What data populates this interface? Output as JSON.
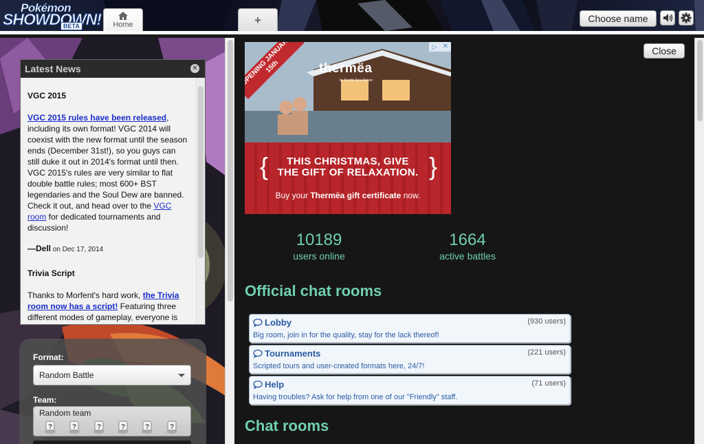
{
  "header": {
    "logo_line1": "Pokémon",
    "logo_line2": "SHOWDOWN!",
    "logo_badge": "BETA",
    "home_tab_label": "Home",
    "new_tab_label": "+",
    "choose_name_label": "Choose name",
    "sound_icon": "speaker-icon",
    "settings_icon": "gear-icon"
  },
  "news": {
    "title": "Latest News",
    "items": [
      {
        "heading": "VGC 2015",
        "link1": "VGC 2015 rules have been released",
        "text1": ", including its own format! VGC 2014 will coexist with the new format until the season ends (December 31st!), so you guys can still duke it out in 2014's format until then. VGC 2015's rules are very similar to flat double battle rules; most 600+ BST legendaries and the Soul Dew are banned. Check it out, and head over to the ",
        "link2": "VGC room",
        "text2": " for dedicated tournaments and discussion!",
        "author": "—Dell",
        "date_prefix": " on ",
        "date": "Dec 17, 2014"
      },
      {
        "heading": "Trivia Script",
        "text1": "Thanks to Morfent's hard work, ",
        "link1": "the Trivia room now has a script!",
        "text2": " Featuring three different modes of gameplay, everyone is welcome to answer questions, join games"
      }
    ]
  },
  "battle_form": {
    "format_label": "Format:",
    "format_value": "Random Battle",
    "team_label": "Team:",
    "team_value": "Random team"
  },
  "main": {
    "close_label": "Close",
    "ad": {
      "banner": "OPENING JANUARY 15th",
      "brand": "thermëa",
      "brand_sub": "by Nordik Spa-Nature",
      "headline": "THIS CHRISTMAS, GIVE THE GIFT OF RELAXATION.",
      "sub_pre": "Buy your ",
      "sub_bold": "Thermëa gift certificate",
      "sub_post": " now."
    },
    "stats": {
      "users_online": "10189",
      "users_online_label": "users online",
      "active_battles": "1664",
      "active_battles_label": "active battles"
    },
    "official_heading": "Official chat rooms",
    "rooms": [
      {
        "name": "Lobby",
        "users": "(930 users)",
        "desc": "Big room, join in for the quality, stay for the lack thereof!"
      },
      {
        "name": "Tournaments",
        "users": "(221 users)",
        "desc": "Scripted tours and user-created formats here, 24/7!"
      },
      {
        "name": "Help",
        "users": "(71 users)",
        "desc": "Having troubles? Ask for help from one of our \"Friendly\" staff."
      }
    ],
    "chat_heading": "Chat rooms"
  },
  "colors": {
    "accent": "#6fcfae",
    "link": "#1a2dc9",
    "room_name": "#2b5aa3"
  }
}
